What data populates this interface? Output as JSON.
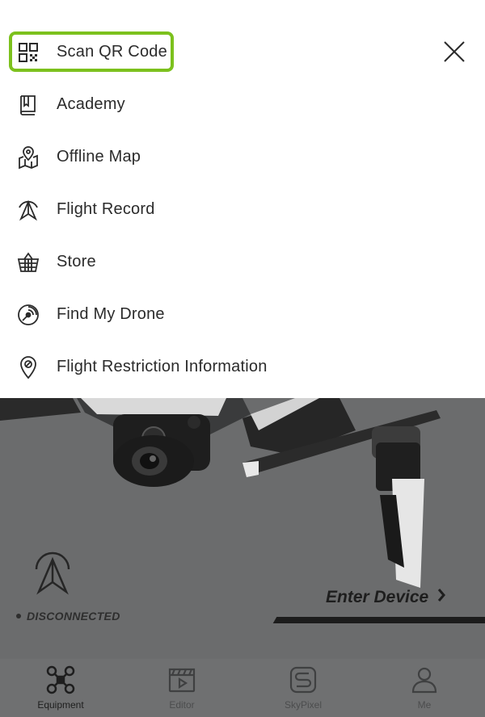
{
  "menu": {
    "items": [
      {
        "label": "Scan QR Code",
        "icon": "qr-code-icon"
      },
      {
        "label": "Academy",
        "icon": "book-icon"
      },
      {
        "label": "Offline Map",
        "icon": "map-pin-icon"
      },
      {
        "label": "Flight Record",
        "icon": "flight-record-icon"
      },
      {
        "label": "Store",
        "icon": "basket-icon"
      },
      {
        "label": "Find My Drone",
        "icon": "radar-icon"
      },
      {
        "label": "Flight Restriction Information",
        "icon": "restriction-pin-icon"
      }
    ],
    "highlight_color": "#7cc11d",
    "close_icon": "close-icon"
  },
  "device": {
    "status": "DISCONNECTED",
    "enter_label": "Enter Device",
    "signal_icon": "aircraft-signal-icon"
  },
  "bottom_nav": {
    "items": [
      {
        "label": "Equipment",
        "icon": "drone-icon",
        "active": true
      },
      {
        "label": "Editor",
        "icon": "clapperboard-icon",
        "active": false
      },
      {
        "label": "SkyPixel",
        "icon": "skypixel-icon",
        "active": false
      },
      {
        "label": "Me",
        "icon": "person-icon",
        "active": false
      }
    ]
  }
}
